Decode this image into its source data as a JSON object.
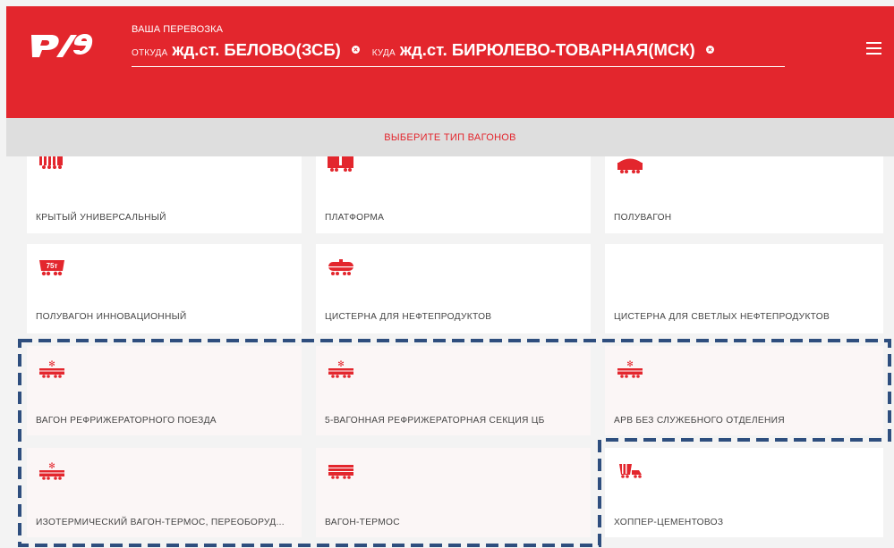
{
  "header": {
    "logo_text": "РЖД",
    "route_title": "ВАША ПЕРЕВОЗКА",
    "from_label": "ОТКУДА",
    "from_value": "жд.ст. БЕЛОВО(ЗСБ)",
    "to_label": "КУДА",
    "to_value": "жд.ст. БИРЮЛЕВО-ТОВАРНАЯ(МСК)",
    "menu_icon": "hamburger-menu-icon"
  },
  "subbar": {
    "title": "ВЫБЕРИТЕ ТИП ВАГОНОВ"
  },
  "colors": {
    "brand_red": "#e3262d",
    "highlight_outline": "#2e4e7e"
  },
  "wagons": [
    {
      "label": "КРЫТЫЙ УНИВЕРСАЛЬНЫЙ",
      "icon": "covered-wagon-icon"
    },
    {
      "label": "ПЛАТФОРМА",
      "icon": "platform-wagon-icon"
    },
    {
      "label": "ПОЛУВАГОН",
      "icon": "gondola-wagon-icon"
    },
    {
      "label": "ПОЛУВАГОН ИННОВАЦИОННЫЙ",
      "icon": "innovative-gondola-icon",
      "badge": "75т"
    },
    {
      "label": "ЦИСТЕРНА ДЛЯ НЕФТЕПРОДУКТОВ",
      "icon": "tank-wagon-icon"
    },
    {
      "label": "ЦИСТЕРНА ДЛЯ СВЕТЛЫХ НЕФТЕПРОДУКТОВ",
      "icon": ""
    },
    {
      "label": "ВАГОН РЕФРИЖЕРАТОРНОГО ПОЕЗДА",
      "icon": "refrigerator-wagon-icon"
    },
    {
      "label": "5-ВАГОННАЯ РЕФРИЖЕРАТОРНАЯ СЕКЦИЯ ЦБ",
      "icon": "refrigerator-wagon-icon"
    },
    {
      "label": "АРВ БЕЗ СЛУЖЕБНОГО ОТДЕЛЕНИЯ",
      "icon": "refrigerator-wagon-icon"
    },
    {
      "label": "ИЗОТЕРМИЧЕСКИЙ ВАГОН-ТЕРМОС, ПЕРЕОБОРУД...",
      "icon": "refrigerator-wagon-icon"
    },
    {
      "label": "ВАГОН-ТЕРМОС",
      "icon": "thermos-wagon-icon"
    },
    {
      "label": "ХОППЕР-ЦЕМЕНТОВОЗ",
      "icon": "hopper-cement-wagon-icon"
    }
  ]
}
